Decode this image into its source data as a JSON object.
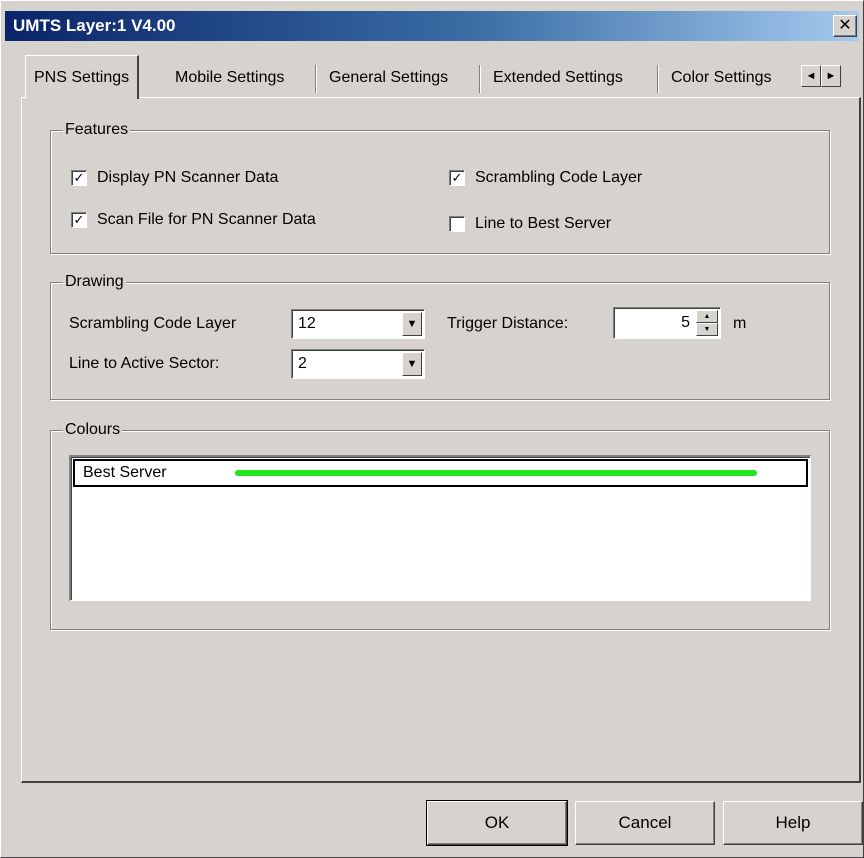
{
  "window": {
    "title": "UMTS Layer:1 V4.00",
    "close_glyph": "✕"
  },
  "tabs": [
    {
      "label": "PNS Settings",
      "active": true
    },
    {
      "label": "Mobile Settings",
      "active": false
    },
    {
      "label": "General Settings",
      "active": false
    },
    {
      "label": "Extended Settings",
      "active": false
    },
    {
      "label": "Color Settings",
      "active": false
    }
  ],
  "tab_scroll": {
    "left": "◄",
    "right": "►"
  },
  "features": {
    "title": "Features",
    "items": [
      {
        "label": "Display PN Scanner Data",
        "checked": true
      },
      {
        "label": "Scan File for PN Scanner Data",
        "checked": true
      },
      {
        "label": "Scrambling Code Layer",
        "checked": true
      },
      {
        "label": "Line to Best Server",
        "checked": false
      }
    ],
    "check_glyph": "✓"
  },
  "drawing": {
    "title": "Drawing",
    "scrambling_label": "Scrambling Code Layer",
    "scrambling_value": "12",
    "line_active_label": "Line to Active Sector:",
    "line_active_value": "2",
    "trigger_label": "Trigger Distance:",
    "trigger_value": "5",
    "trigger_unit": "m",
    "dropdown_glyph": "▼",
    "spin_up": "▲",
    "spin_down": "▼"
  },
  "colours": {
    "title": "Colours",
    "rows": [
      {
        "label": "Best Server",
        "color": "#22e51e"
      }
    ]
  },
  "buttons": {
    "ok": "OK",
    "cancel": "Cancel",
    "help": "Help"
  }
}
